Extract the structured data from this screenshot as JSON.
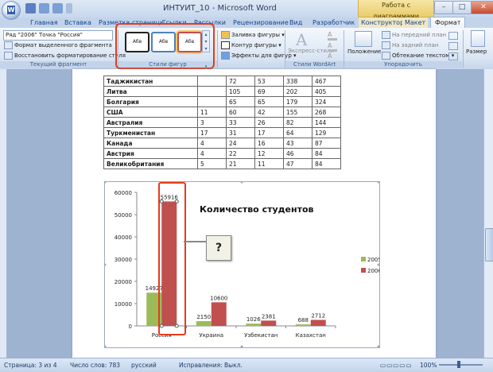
{
  "window": {
    "title": "ИНТУИТ_10 - Microsoft Word",
    "context_title": "Работа с диаграммами",
    "controls": [
      "–",
      "□",
      "✕"
    ]
  },
  "tabs": [
    "Главная",
    "Вставка",
    "Разметка страницы",
    "Ссылки",
    "Рассылки",
    "Рецензирование",
    "Вид",
    "Разработчик",
    "Конструктор",
    "Макет",
    "Формат"
  ],
  "ribbon": {
    "current_fragment": {
      "selector_value": "Ряд \"2006\" Точка \"Россия\"",
      "format_selection": "Формат выделенного фрагмента",
      "reset_style": "Восстановить форматирование стиля",
      "caption": "Текущий фрагмент"
    },
    "shape_styles": {
      "swatches": [
        "Абв",
        "Абв",
        "Абв"
      ],
      "caption": "Стили фигур",
      "fill": "Заливка фигуры",
      "outline": "Контур фигуры",
      "effects": "Эффекты для фигур"
    },
    "wordart": {
      "express_styles": "Экспресс-стили",
      "caption": "Стили WordArt"
    },
    "arrange": {
      "position": "Положение",
      "bring_front": "На передний план",
      "send_back": "На задний план",
      "wrap_text": "Обтекание текстом",
      "caption": "Упорядочить"
    },
    "size": "Размер"
  },
  "table_rows": [
    [
      "Таджикистан",
      "",
      "72",
      "53",
      "338",
      "467"
    ],
    [
      "Литва",
      "",
      "105",
      "69",
      "202",
      "405"
    ],
    [
      "Болгария",
      "",
      "65",
      "65",
      "179",
      "324"
    ],
    [
      "США",
      "11",
      "60",
      "42",
      "155",
      "268"
    ],
    [
      "Австралия",
      "3",
      "33",
      "26",
      "82",
      "144"
    ],
    [
      "Туркменистан",
      "17",
      "31",
      "17",
      "64",
      "129"
    ],
    [
      "Канада",
      "4",
      "24",
      "16",
      "43",
      "87"
    ],
    [
      "Австрия",
      "4",
      "22",
      "12",
      "46",
      "84"
    ],
    [
      "Великобритания",
      "5",
      "21",
      "11",
      "47",
      "84"
    ]
  ],
  "chart_data": {
    "type": "bar",
    "title": "Количество студентов",
    "categories": [
      "Россия",
      "Украина",
      "Узбекистан",
      "Казахстан"
    ],
    "series": [
      {
        "name": "2005",
        "values": [
          14927,
          2150,
          1026,
          688
        ],
        "color": "#9bbb59"
      },
      {
        "name": "2006",
        "values": [
          55916,
          10600,
          2381,
          2712
        ],
        "color": "#c0504d"
      }
    ],
    "ylim": [
      0,
      60000
    ],
    "yticks": [
      "0",
      "10000",
      "20000",
      "30000",
      "40000",
      "50000",
      "60000"
    ],
    "legend": "right",
    "grid": false
  },
  "callouts": [
    "?",
    "?"
  ],
  "statusbar": {
    "page": "Страница: 3 из 4",
    "words": "Число слов: 783",
    "language": "русский",
    "track_changes": "Исправления: Выкл.",
    "zoom": "100%"
  },
  "colors": {
    "highlight": "#e53b1c",
    "series_2005": "#9bbb59",
    "series_2006": "#c0504d"
  }
}
